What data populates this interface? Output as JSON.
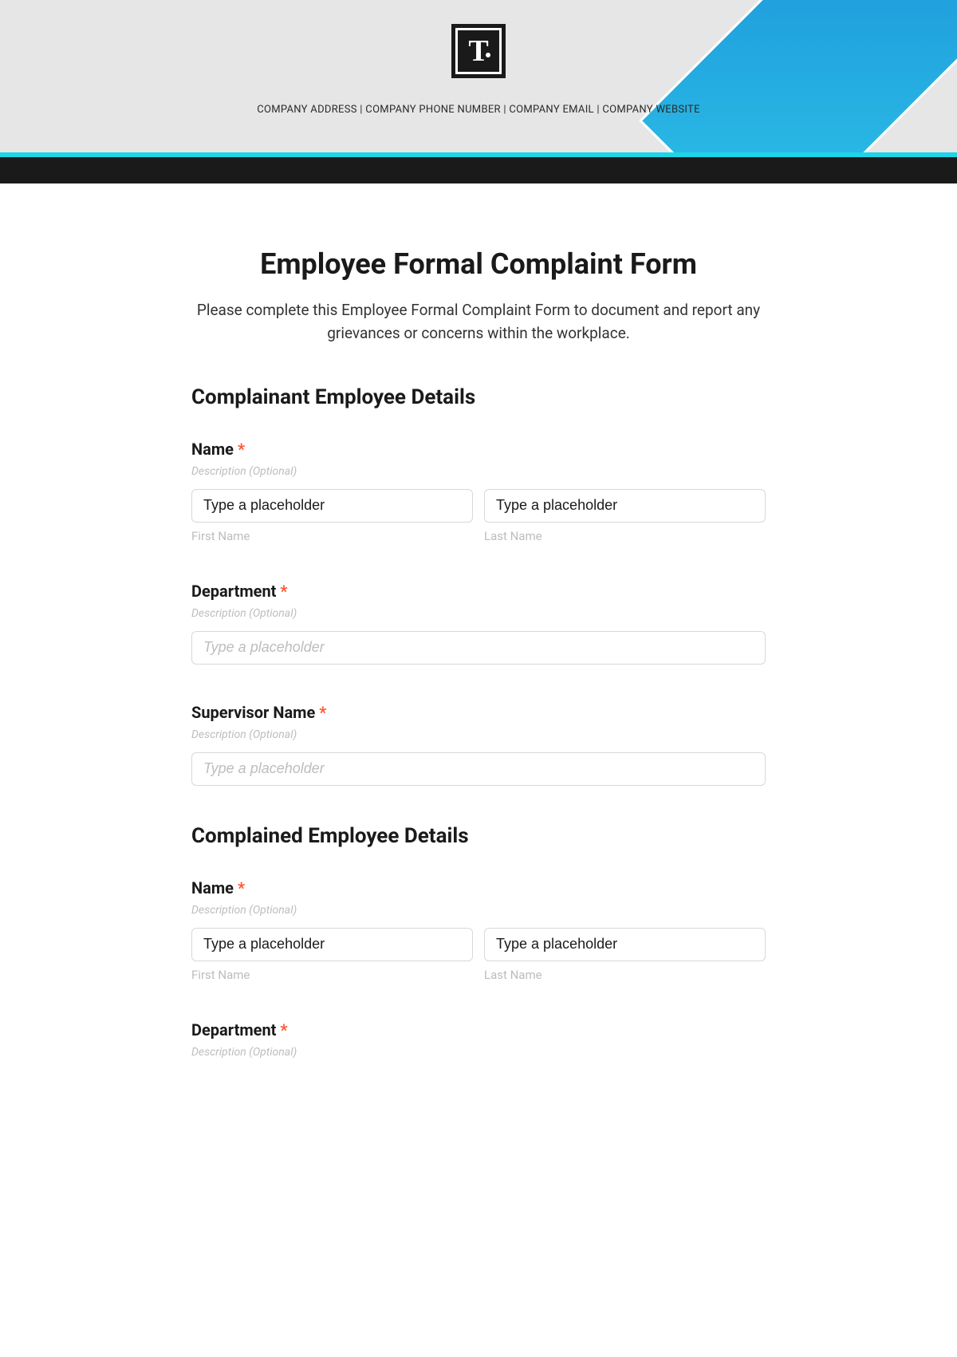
{
  "header": {
    "company_line": "COMPANY ADDRESS | COMPANY PHONE NUMBER | COMPANY EMAIL | COMPANY WEBSITE"
  },
  "form": {
    "title": "Employee Formal Complaint Form",
    "description": "Please complete this Employee Formal Complaint Form to document and report any grievances or concerns within the workplace."
  },
  "sections": {
    "complainant": {
      "title": "Complainant Employee Details",
      "name": {
        "label": "Name",
        "hint": "Description (Optional)",
        "first_value": "Type a placeholder",
        "last_value": "Type a placeholder",
        "first_sub": "First Name",
        "last_sub": "Last Name"
      },
      "department": {
        "label": "Department",
        "hint": "Description (Optional)",
        "placeholder": "Type a placeholder"
      },
      "supervisor": {
        "label": "Supervisor Name",
        "hint": "Description (Optional)",
        "placeholder": "Type a placeholder"
      }
    },
    "complained": {
      "title": "Complained Employee Details",
      "name": {
        "label": "Name",
        "hint": "Description (Optional)",
        "first_value": "Type a placeholder",
        "last_value": "Type a placeholder",
        "first_sub": "First Name",
        "last_sub": "Last Name"
      },
      "department": {
        "label": "Department",
        "hint": "Description (Optional)"
      }
    }
  },
  "required_marker": "*"
}
